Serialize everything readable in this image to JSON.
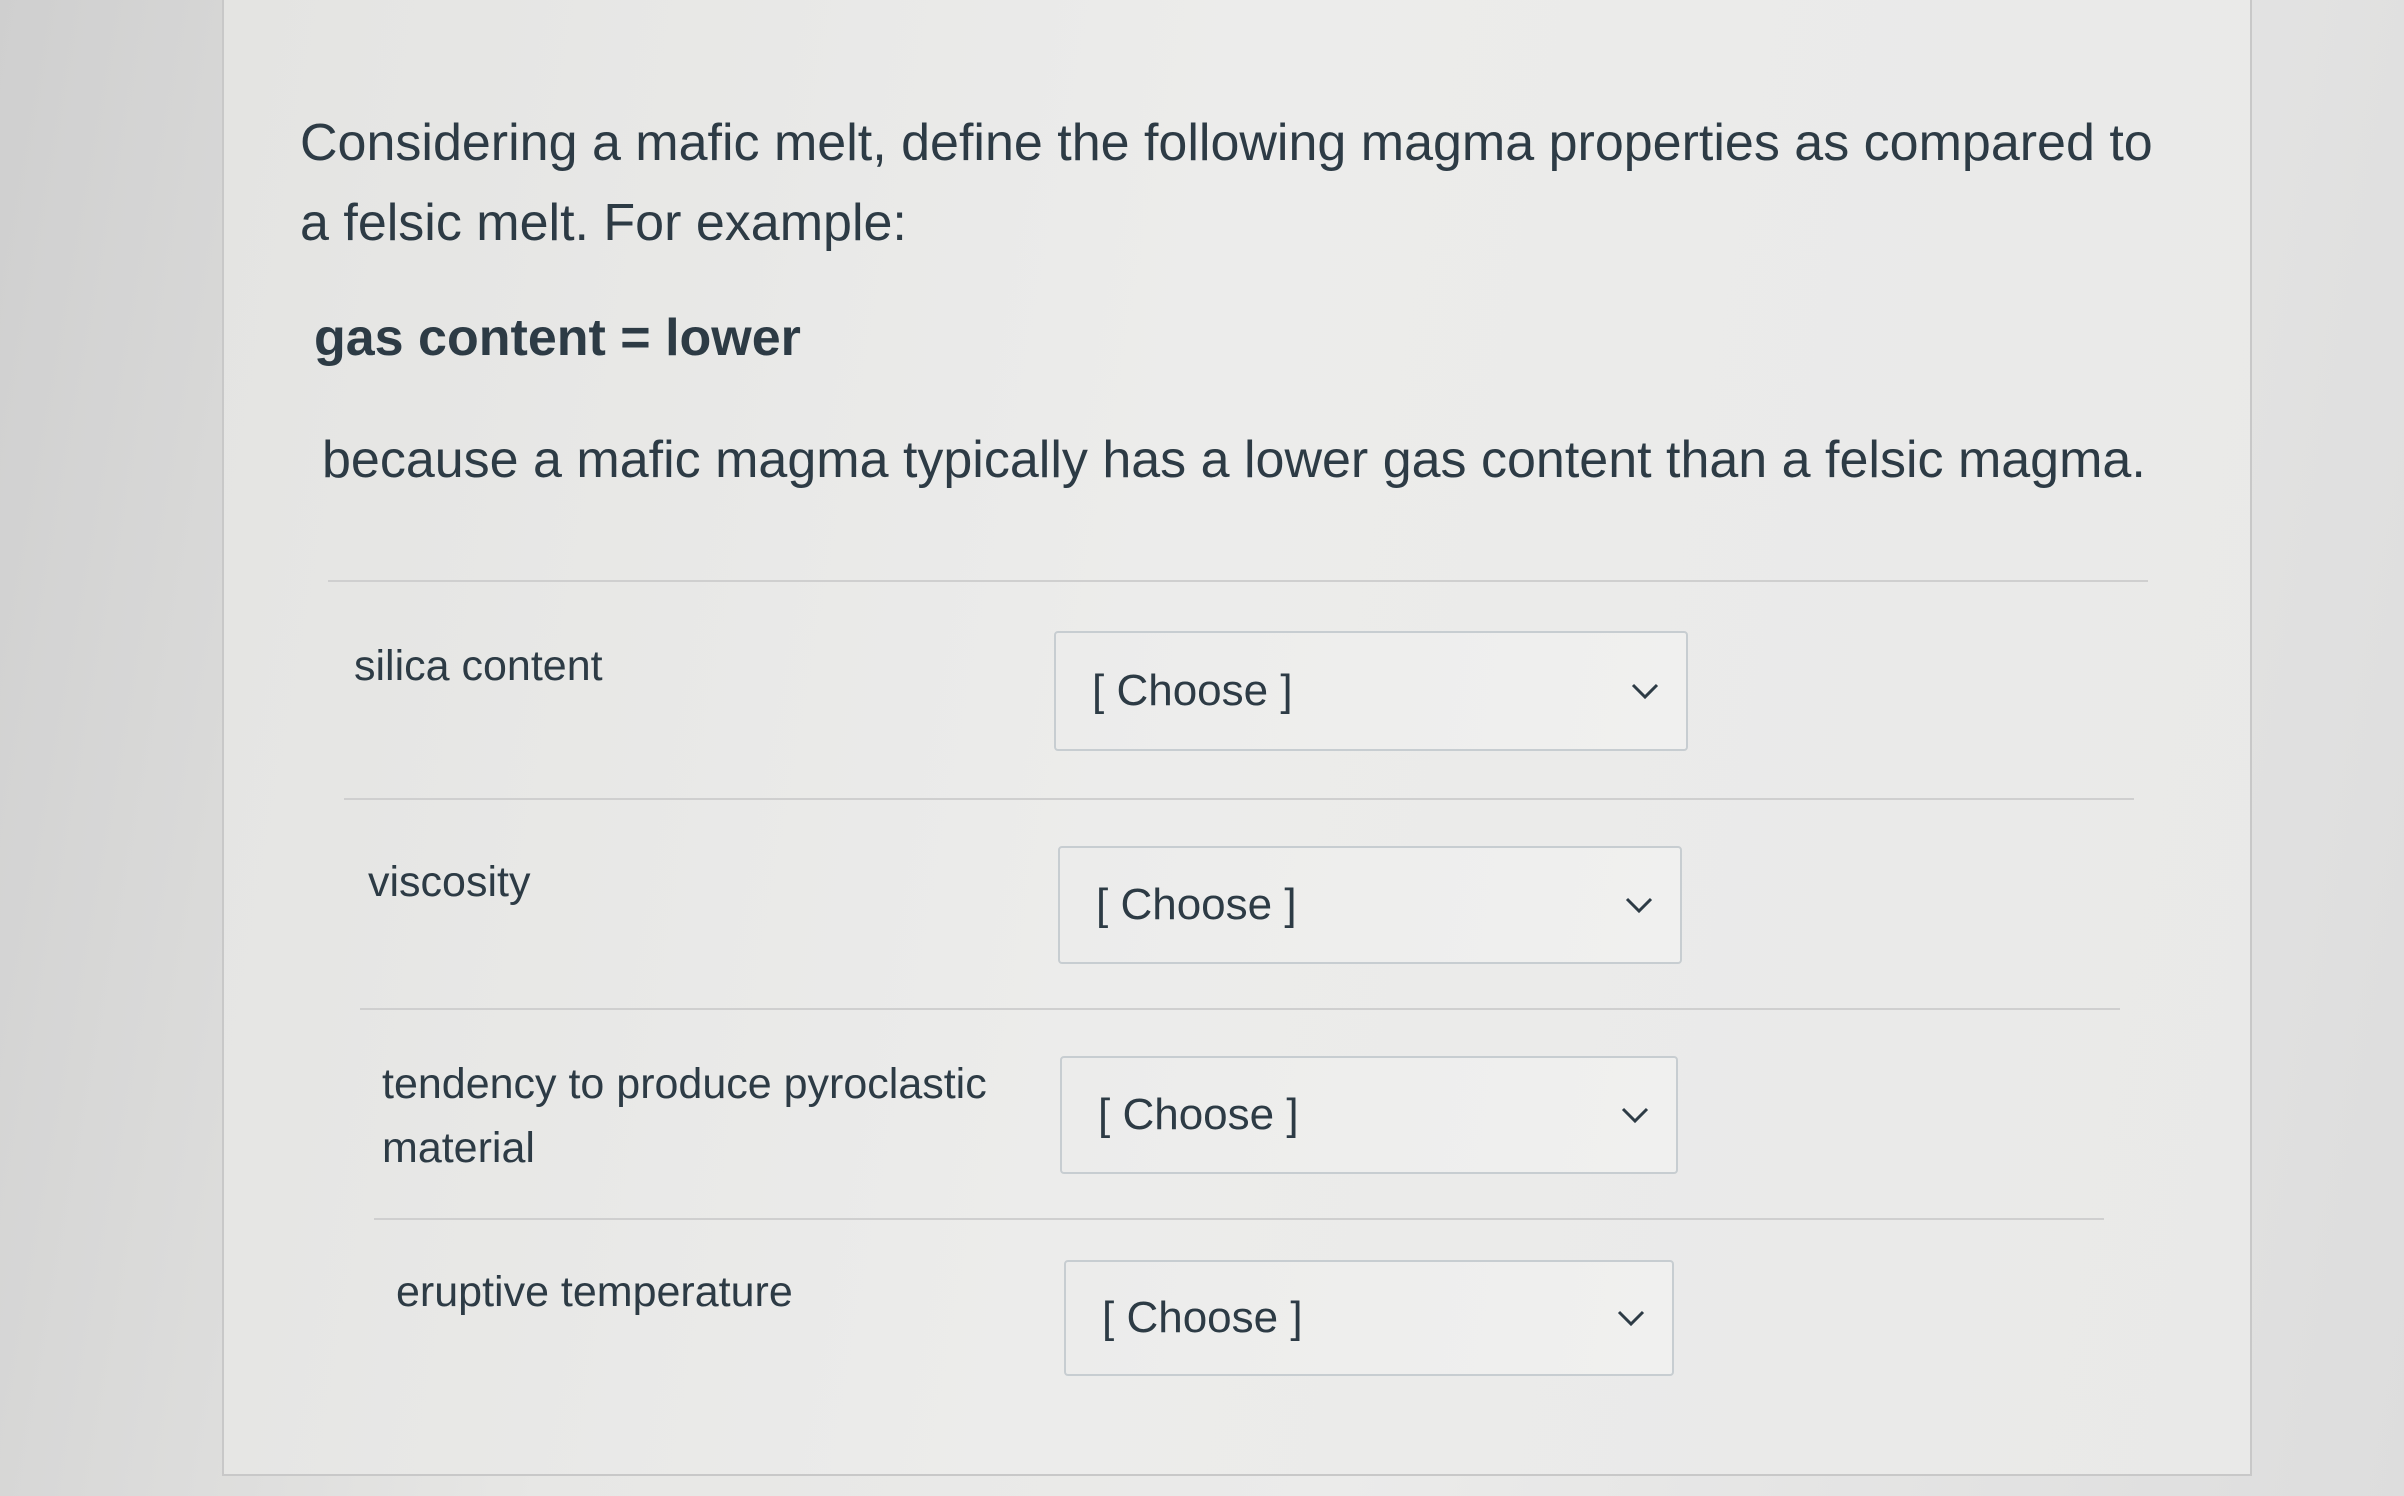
{
  "question": {
    "prompt": "Considering a mafic melt, define the following magma properties as compared to a felsic melt. For example:",
    "example": "gas content = lower",
    "explanation": "because a mafic magma typically has a lower gas content than a felsic magma."
  },
  "items": [
    {
      "label": "silica content",
      "selected": "[ Choose ]"
    },
    {
      "label": "viscosity",
      "selected": "[ Choose ]"
    },
    {
      "label": "tendency to produce pyroclastic material",
      "selected": "[ Choose ]"
    },
    {
      "label": "eruptive temperature",
      "selected": "[ Choose ]"
    }
  ],
  "icons": {
    "dropdown": "chevron-down-icon"
  }
}
